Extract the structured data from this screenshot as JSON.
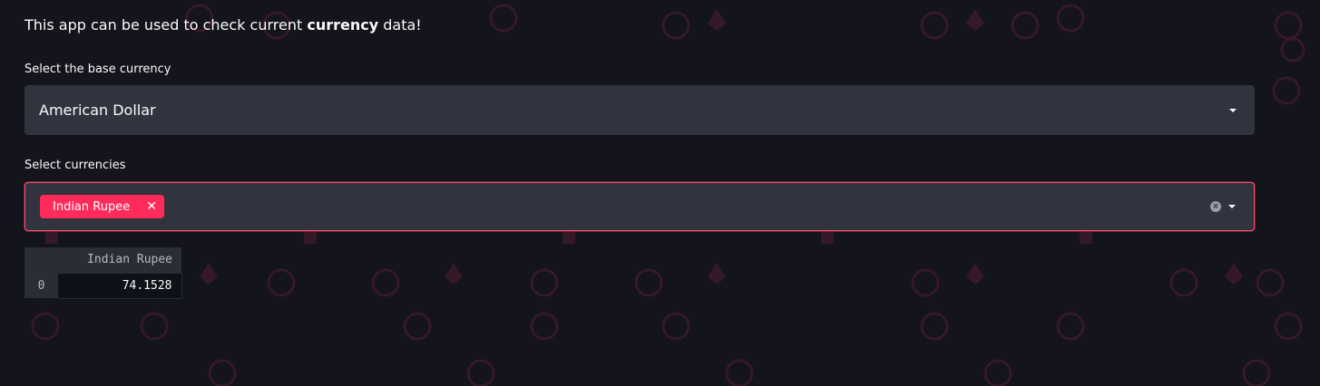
{
  "intro": {
    "prefix": "This app can be used to check current ",
    "bold": "currency",
    "suffix": " data!"
  },
  "base_currency": {
    "label": "Select the base currency",
    "selected": "American Dollar"
  },
  "currencies": {
    "label": "Select currencies",
    "tags": [
      "Indian Rupee"
    ]
  },
  "table": {
    "columns": [
      "Indian Rupee"
    ],
    "rows": [
      {
        "index": "0",
        "values": [
          "74.1528"
        ]
      }
    ]
  },
  "colors": {
    "background": "#13141c",
    "accent": "#ff2b5b",
    "input_bg": "#31333f"
  },
  "icons": {
    "dropdown": "chevron-down-icon",
    "clear": "clear-icon",
    "remove_tag": "close-icon",
    "background": "crypto-coin-icons"
  }
}
